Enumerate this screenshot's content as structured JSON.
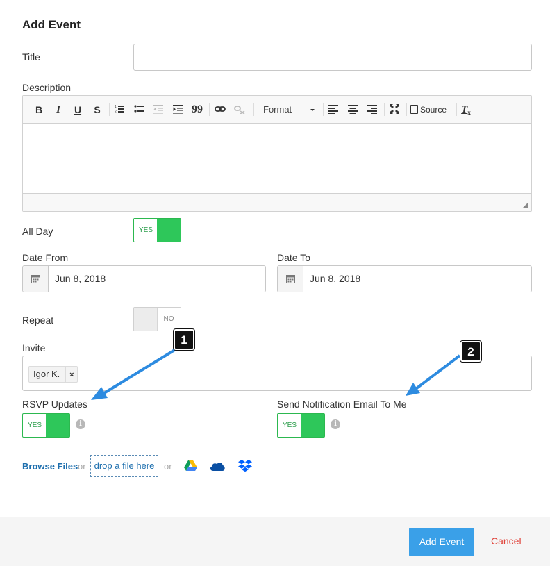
{
  "form": {
    "heading": "Add Event",
    "title_label": "Title",
    "title_value": "",
    "description_label": "Description",
    "all_day_label": "All Day",
    "all_day_toggle": "YES",
    "date_from_label": "Date From",
    "date_from_value": "Jun 8, 2018",
    "date_to_label": "Date To",
    "date_to_value": "Jun 8, 2018",
    "repeat_label": "Repeat",
    "repeat_toggle": "NO",
    "invite_label": "Invite",
    "invitees": [
      {
        "name": "Igor K.",
        "remove": "×"
      }
    ],
    "rsvp_label": "RSVP Updates",
    "rsvp_toggle": "YES",
    "notify_label": "Send Notification Email To Me",
    "notify_toggle": "YES",
    "info_glyph": "i"
  },
  "editor_toolbar": {
    "bold": "B",
    "italic": "I",
    "underline": "U",
    "strike": "S",
    "quote": "99",
    "format": "Format",
    "source": "Source",
    "remove_format": "T"
  },
  "files": {
    "browse": "Browse Files",
    "or_1": "or",
    "drop": "drop a file here",
    "or_2": "or",
    "providers": [
      "google-drive-icon",
      "onedrive-icon",
      "dropbox-icon"
    ]
  },
  "footer": {
    "add": "Add Event",
    "cancel": "Cancel"
  },
  "callouts": [
    "1",
    "2"
  ],
  "colors": {
    "accent_green": "#2ec75a",
    "primary_blue": "#3aa0e8",
    "link_blue": "#1e6fae",
    "cancel_red": "#e0443b",
    "callout_arrow": "#2d8be0"
  }
}
